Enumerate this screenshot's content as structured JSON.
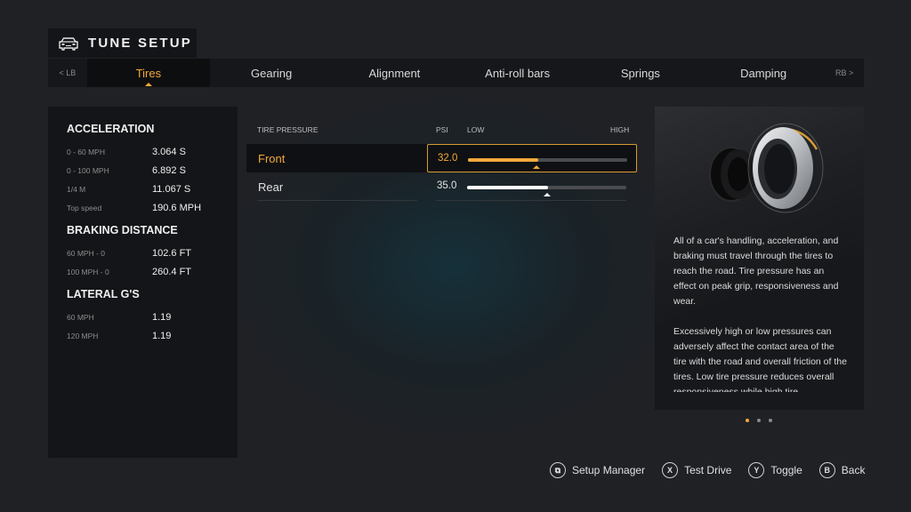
{
  "header": {
    "title": "TUNE SETUP",
    "icon": "car-icon"
  },
  "tabs": {
    "prev_label": "< LB",
    "next_label": "RB >",
    "items": [
      {
        "label": "Tires",
        "active": true
      },
      {
        "label": "Gearing",
        "active": false
      },
      {
        "label": "Alignment",
        "active": false
      },
      {
        "label": "Anti-roll bars",
        "active": false
      },
      {
        "label": "Springs",
        "active": false
      },
      {
        "label": "Damping",
        "active": false
      }
    ]
  },
  "stats": {
    "acceleration": {
      "heading": "ACCELERATION",
      "rows": [
        {
          "label": "0 - 60 MPH",
          "value": "3.064 S"
        },
        {
          "label": "0 - 100 MPH",
          "value": "6.892 S"
        },
        {
          "label": "1/4 M",
          "value": "11.067 S"
        },
        {
          "label": "Top speed",
          "value": "190.6 MPH"
        }
      ]
    },
    "braking": {
      "heading": "BRAKING DISTANCE",
      "rows": [
        {
          "label": "60 MPH - 0",
          "value": "102.6 FT"
        },
        {
          "label": "100 MPH - 0",
          "value": "260.4 FT"
        }
      ]
    },
    "lateral": {
      "heading": "LATERAL G'S",
      "rows": [
        {
          "label": "60 MPH",
          "value": "1.19"
        },
        {
          "label": "120 MPH",
          "value": "1.19"
        }
      ]
    }
  },
  "tuning": {
    "section_label": "TIRE PRESSURE",
    "unit_label": "PSI",
    "low_label": "LOW",
    "high_label": "HIGH",
    "rows": [
      {
        "name": "Front",
        "value": "32.0",
        "fill_fraction": 0.44,
        "marker_fraction": 0.43,
        "selected": true
      },
      {
        "name": "Rear",
        "value": "35.0",
        "fill_fraction": 0.51,
        "marker_fraction": 0.5,
        "selected": false
      }
    ]
  },
  "info": {
    "image": "tire-illustration",
    "paragraphs": [
      "All of a car's handling, acceleration, and braking must travel through the tires to reach the road. Tire pressure has an effect on peak grip, responsiveness and wear.",
      "Excessively high or low pressures can adversely affect the contact area of the tire with the road and overall friction of the tires. Low tire pressure reduces overall responsiveness while high tire"
    ],
    "pages": 3,
    "current_page": 1
  },
  "footer": {
    "hints": [
      {
        "glyph": "view-button-icon",
        "symbol": "⧉",
        "label": "Setup Manager"
      },
      {
        "glyph": "x-button-icon",
        "symbol": "X",
        "label": "Test Drive"
      },
      {
        "glyph": "y-button-icon",
        "symbol": "Y",
        "label": "Toggle"
      },
      {
        "glyph": "b-button-icon",
        "symbol": "B",
        "label": "Back"
      }
    ]
  },
  "colors": {
    "accent": "#f2a93b",
    "panel": "#141518",
    "background": "#202125"
  }
}
